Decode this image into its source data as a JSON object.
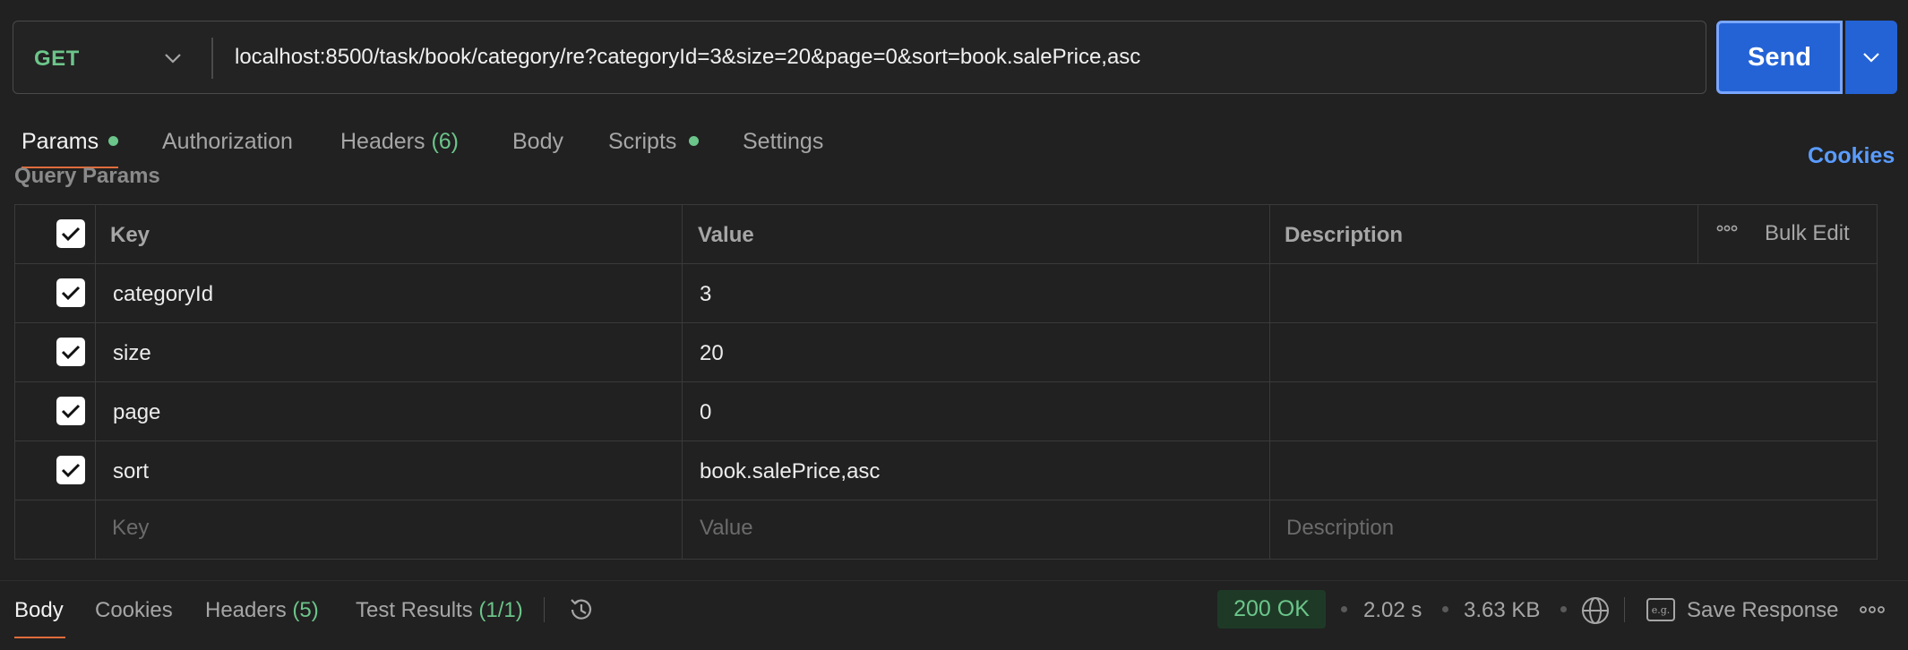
{
  "request": {
    "method": "GET",
    "url": "localhost:8500/task/book/category/re?categoryId=3&size=20&page=0&sort=book.salePrice,asc",
    "send_label": "Send"
  },
  "tabs": {
    "params": "Params",
    "authorization": "Authorization",
    "headers": "Headers",
    "headers_count": "(6)",
    "body": "Body",
    "scripts": "Scripts",
    "settings": "Settings",
    "cookies": "Cookies"
  },
  "query_params": {
    "title": "Query Params",
    "columns": {
      "key": "Key",
      "value": "Value",
      "description": "Description"
    },
    "bulk_edit": "Bulk Edit",
    "rows": [
      {
        "key": "categoryId",
        "value": "3",
        "checked": true
      },
      {
        "key": "size",
        "value": "20",
        "checked": true
      },
      {
        "key": "page",
        "value": "0",
        "checked": true
      },
      {
        "key": "sort",
        "value": "book.salePrice,asc",
        "checked": true
      }
    ],
    "placeholders": {
      "key": "Key",
      "value": "Value",
      "description": "Description"
    }
  },
  "response": {
    "tabs": {
      "body": "Body",
      "cookies": "Cookies",
      "headers": "Headers",
      "headers_count": "(5)",
      "test_results": "Test Results",
      "test_results_count": "(1/1)"
    },
    "status": "200 OK",
    "time": "2.02 s",
    "size": "3.63 KB",
    "save_response": "Save Response"
  },
  "colors": {
    "accent": "#2463d6",
    "success": "#6cc58a",
    "active_tab": "#e06c3c",
    "link": "#5a9cff"
  }
}
